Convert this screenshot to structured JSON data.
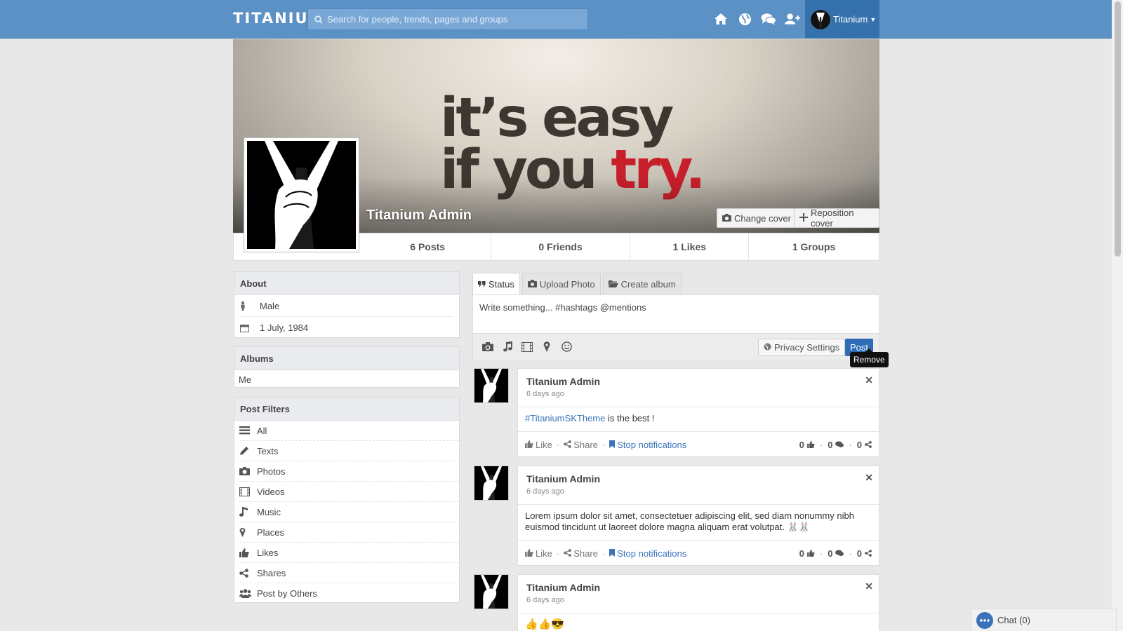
{
  "app": {
    "logo": "TITANIUM"
  },
  "header": {
    "search_placeholder": "Search for people, trends, pages and groups",
    "user_name": "Titanium",
    "icons": [
      "home-icon",
      "globe-icon",
      "messages-icon",
      "add-friend-icon"
    ]
  },
  "cover": {
    "slogan_line1": "it’s easy",
    "slogan_line2_a": "if you ",
    "slogan_line2_b": "try.",
    "profile_name": "Titanium Admin",
    "change_cover": "Change cover",
    "reposition_cover": "Reposition cover"
  },
  "stats": {
    "posts": "6 Posts",
    "friends": "0 Friends",
    "likes": "1 Likes",
    "groups": "1 Groups"
  },
  "about": {
    "title": "About",
    "gender": "Male",
    "birthday": "1 July, 1984"
  },
  "albums": {
    "title": "Albums",
    "items": [
      "Me"
    ]
  },
  "filters": {
    "title": "Post Filters",
    "items": [
      "All",
      "Texts",
      "Photos",
      "Videos",
      "Music",
      "Places",
      "Likes",
      "Shares",
      "Post by Others"
    ]
  },
  "composer": {
    "tabs": [
      "Status",
      "Upload Photo",
      "Create album"
    ],
    "placeholder": "Write something... #hashtags @mentions",
    "privacy": "Privacy Settings",
    "post": "Post",
    "tooltip": "Remove"
  },
  "posts": [
    {
      "author": "Titanium Admin",
      "time": "6 days ago",
      "hashtag": "#TitaniumSKTheme",
      "text": " is the best !",
      "likes": "0",
      "comments": "0",
      "shares": "0"
    },
    {
      "author": "Titanium Admin",
      "time": "6 days ago",
      "text": "Lorem ipsum dolor sit amet, consectetuer adipiscing elit, sed diam nonummy nibh euismod tincidunt ut laoreet dolore magna aliquam erat volutpat. 🐰🐰",
      "likes": "0",
      "comments": "0",
      "shares": "0"
    },
    {
      "author": "Titanium Admin",
      "time": "6 days ago",
      "text": "👍👍😎"
    }
  ],
  "post_actions": {
    "like": "Like",
    "share": "Share",
    "stop": "Stop notifications"
  },
  "chat": {
    "label": "Chat (0)"
  },
  "colors": {
    "header": "#5b91c4",
    "user_menu": "#3572ad",
    "link": "#3b73b9",
    "post_button": "#2e6cb5"
  }
}
